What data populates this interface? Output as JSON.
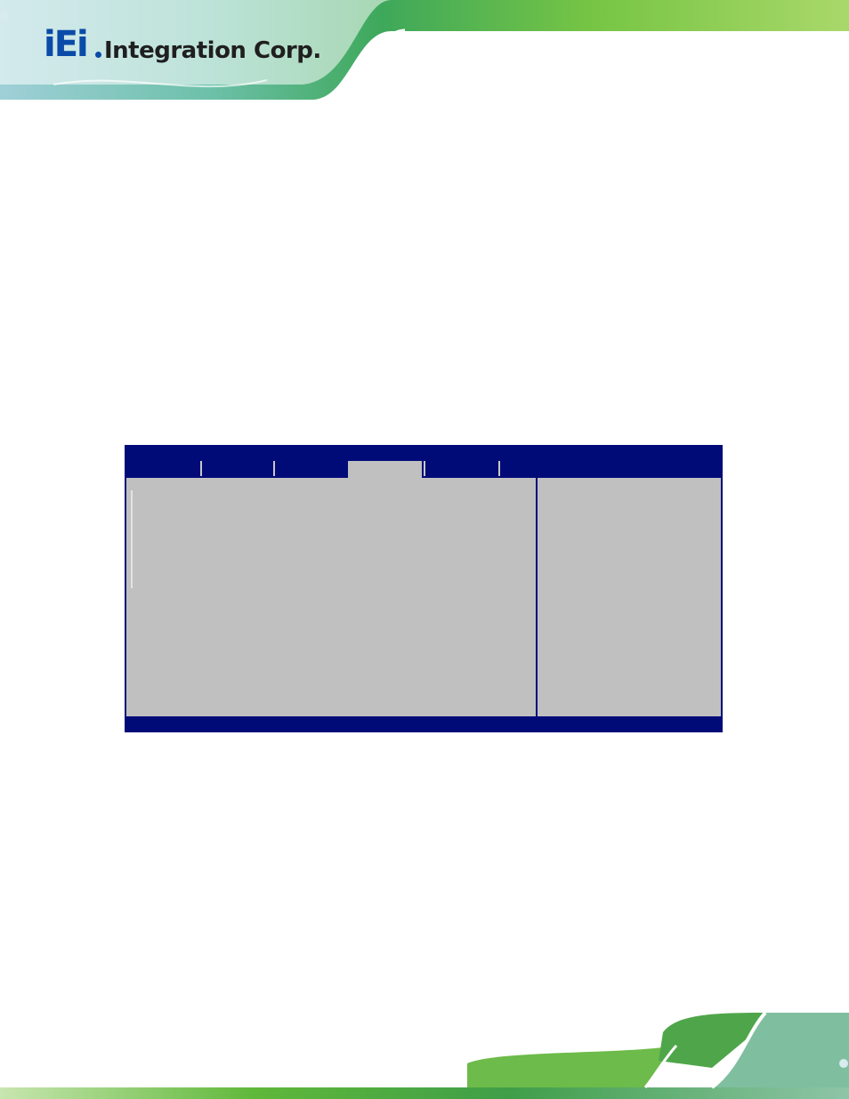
{
  "header": {
    "logo_mark": "iEi",
    "logo_text": "Integration Corp."
  },
  "colors": {
    "bios_blue": "#000b78",
    "bios_gray": "#c0c0c0",
    "banner_green": "#5fb83a",
    "logo_blue": "#0a4aa8"
  },
  "bios": {
    "tabs": [
      "",
      "",
      "",
      "",
      "",
      ""
    ],
    "active_tab_index": 3
  }
}
